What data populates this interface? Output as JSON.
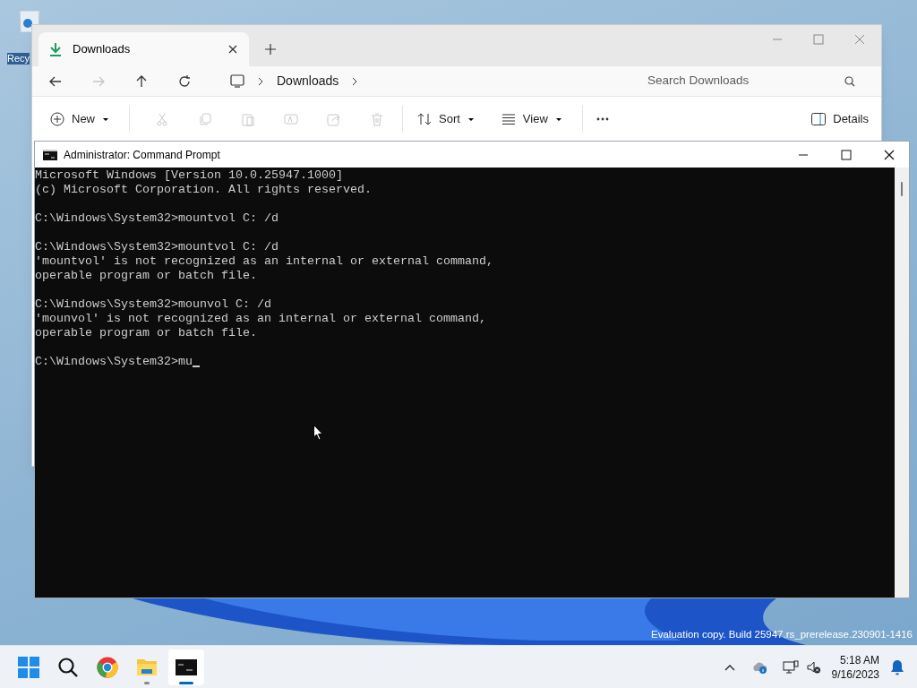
{
  "desktop": {
    "icon_label": "Recy",
    "watermark": "Evaluation copy. Build 25947.rs_prerelease.230901-1416"
  },
  "explorer": {
    "tabs": [
      {
        "label": "Downloads",
        "selected": true
      }
    ],
    "nav_buttons": [
      {
        "kind": "back",
        "disabled": false
      },
      {
        "kind": "forward",
        "disabled": true
      },
      {
        "kind": "up",
        "disabled": false
      },
      {
        "kind": "refresh",
        "disabled": false
      }
    ],
    "breadcrumb": [
      "Downloads"
    ],
    "search": {
      "placeholder": "Search Downloads"
    },
    "toolbar": [
      {
        "kind": "new",
        "label": "New",
        "disabled": false
      },
      {
        "kind": "cut",
        "disabled": true
      },
      {
        "kind": "copy",
        "disabled": true
      },
      {
        "kind": "paste",
        "disabled": true
      },
      {
        "kind": "rename",
        "disabled": true
      },
      {
        "kind": "share",
        "disabled": true
      },
      {
        "kind": "delete",
        "disabled": true
      },
      {
        "kind": "sort",
        "label": "Sort",
        "disabled": false
      },
      {
        "kind": "view",
        "label": "View",
        "disabled": false
      },
      {
        "kind": "more",
        "disabled": false
      }
    ],
    "details_button": "Details"
  },
  "cmd": {
    "title": "Administrator: Command Prompt",
    "blocks": [
      [
        "Microsoft Windows [Version 10.0.25947.1000]",
        "(c) Microsoft Corporation. All rights reserved."
      ],
      [
        "C:\\Windows\\System32>mountvol C: /d"
      ],
      [
        "C:\\Windows\\System32>mountvol C: /d",
        "'mountvol' is not recognized as an internal or external command,",
        "operable program or batch file."
      ],
      [
        "C:\\Windows\\System32>mounvol C: /d",
        "'mounvol' is not recognized as an internal or external command,",
        "operable program or batch file."
      ],
      [
        "C:\\Windows\\System32>mu"
      ]
    ]
  },
  "taskbar": {
    "apps": [
      {
        "kind": "start",
        "selected": false,
        "running": false
      },
      {
        "kind": "search",
        "selected": false,
        "running": false
      },
      {
        "kind": "chrome",
        "selected": false,
        "running": false
      },
      {
        "kind": "explorer",
        "selected": false,
        "running": true
      },
      {
        "kind": "terminal",
        "selected": true,
        "running": true
      }
    ],
    "time": "5:18 AM",
    "date": "9/16/2023"
  }
}
